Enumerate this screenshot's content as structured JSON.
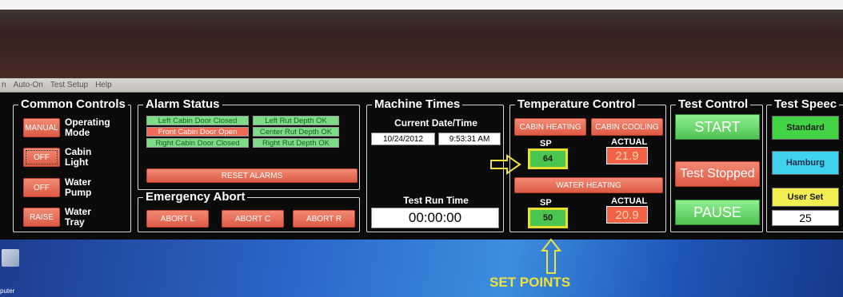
{
  "menu": [
    "n",
    "Auto-On",
    "Test Setup",
    "Help"
  ],
  "common_controls": {
    "title": "Common Controls",
    "rows": [
      {
        "button": "MANUAL",
        "label": "Operating Mode"
      },
      {
        "button": "OFF",
        "label": "Cabin Light"
      },
      {
        "button": "OFF",
        "label": "Water Pump"
      },
      {
        "button": "RAISE",
        "label": "Water Tray"
      }
    ]
  },
  "alarm_status": {
    "title": "Alarm Status",
    "left": [
      {
        "text": "Left Cabin Door Closed",
        "state": "ok"
      },
      {
        "text": "Front Cabin Door Open",
        "state": "alarm"
      },
      {
        "text": "Right Cabin Door Closed",
        "state": "ok"
      }
    ],
    "right": [
      {
        "text": "Left Rut Depth OK",
        "state": "ok"
      },
      {
        "text": "Center Rut Depth OK",
        "state": "ok"
      },
      {
        "text": "Right Rut Depth OK",
        "state": "ok"
      }
    ],
    "reset_label": "RESET ALARMS"
  },
  "emergency_abort": {
    "title": "Emergency Abort",
    "buttons": [
      "ABORT L",
      "ABORT C",
      "ABORT R"
    ]
  },
  "machine_times": {
    "title": "Machine Times",
    "current_label": "Current Date/Time",
    "date": "10/24/2012",
    "time": "9:53:31 AM",
    "run_label": "Test Run Time",
    "run_time": "00:00:00"
  },
  "temperature_control": {
    "title": "Temperature Control",
    "cabin_heating": "CABIN HEATING",
    "cabin_cooling": "CABIN COOLING",
    "sp_label": "SP",
    "actual_label": "ACTUAL",
    "cabin_sp": "64",
    "cabin_actual": "21.9",
    "water_heating": "WATER HEATING",
    "water_sp": "50",
    "water_actual": "20.9"
  },
  "test_control": {
    "title": "Test Control",
    "start": "START",
    "status": "Test Stopped",
    "pause": "PAUSE"
  },
  "test_speed": {
    "title": "Test Speec",
    "options": [
      "Standard",
      "Hamburg",
      "User Set"
    ],
    "value": "25"
  },
  "desktop": {
    "icon_label": "puter",
    "annotation": "SET POINTS"
  },
  "colors": {
    "alarm_ok": "#7ddc85",
    "alarm_bad": "#f06a55",
    "button_red": "#e9654f",
    "button_green": "#5fd062",
    "setpoint_border": "#e8e030"
  }
}
